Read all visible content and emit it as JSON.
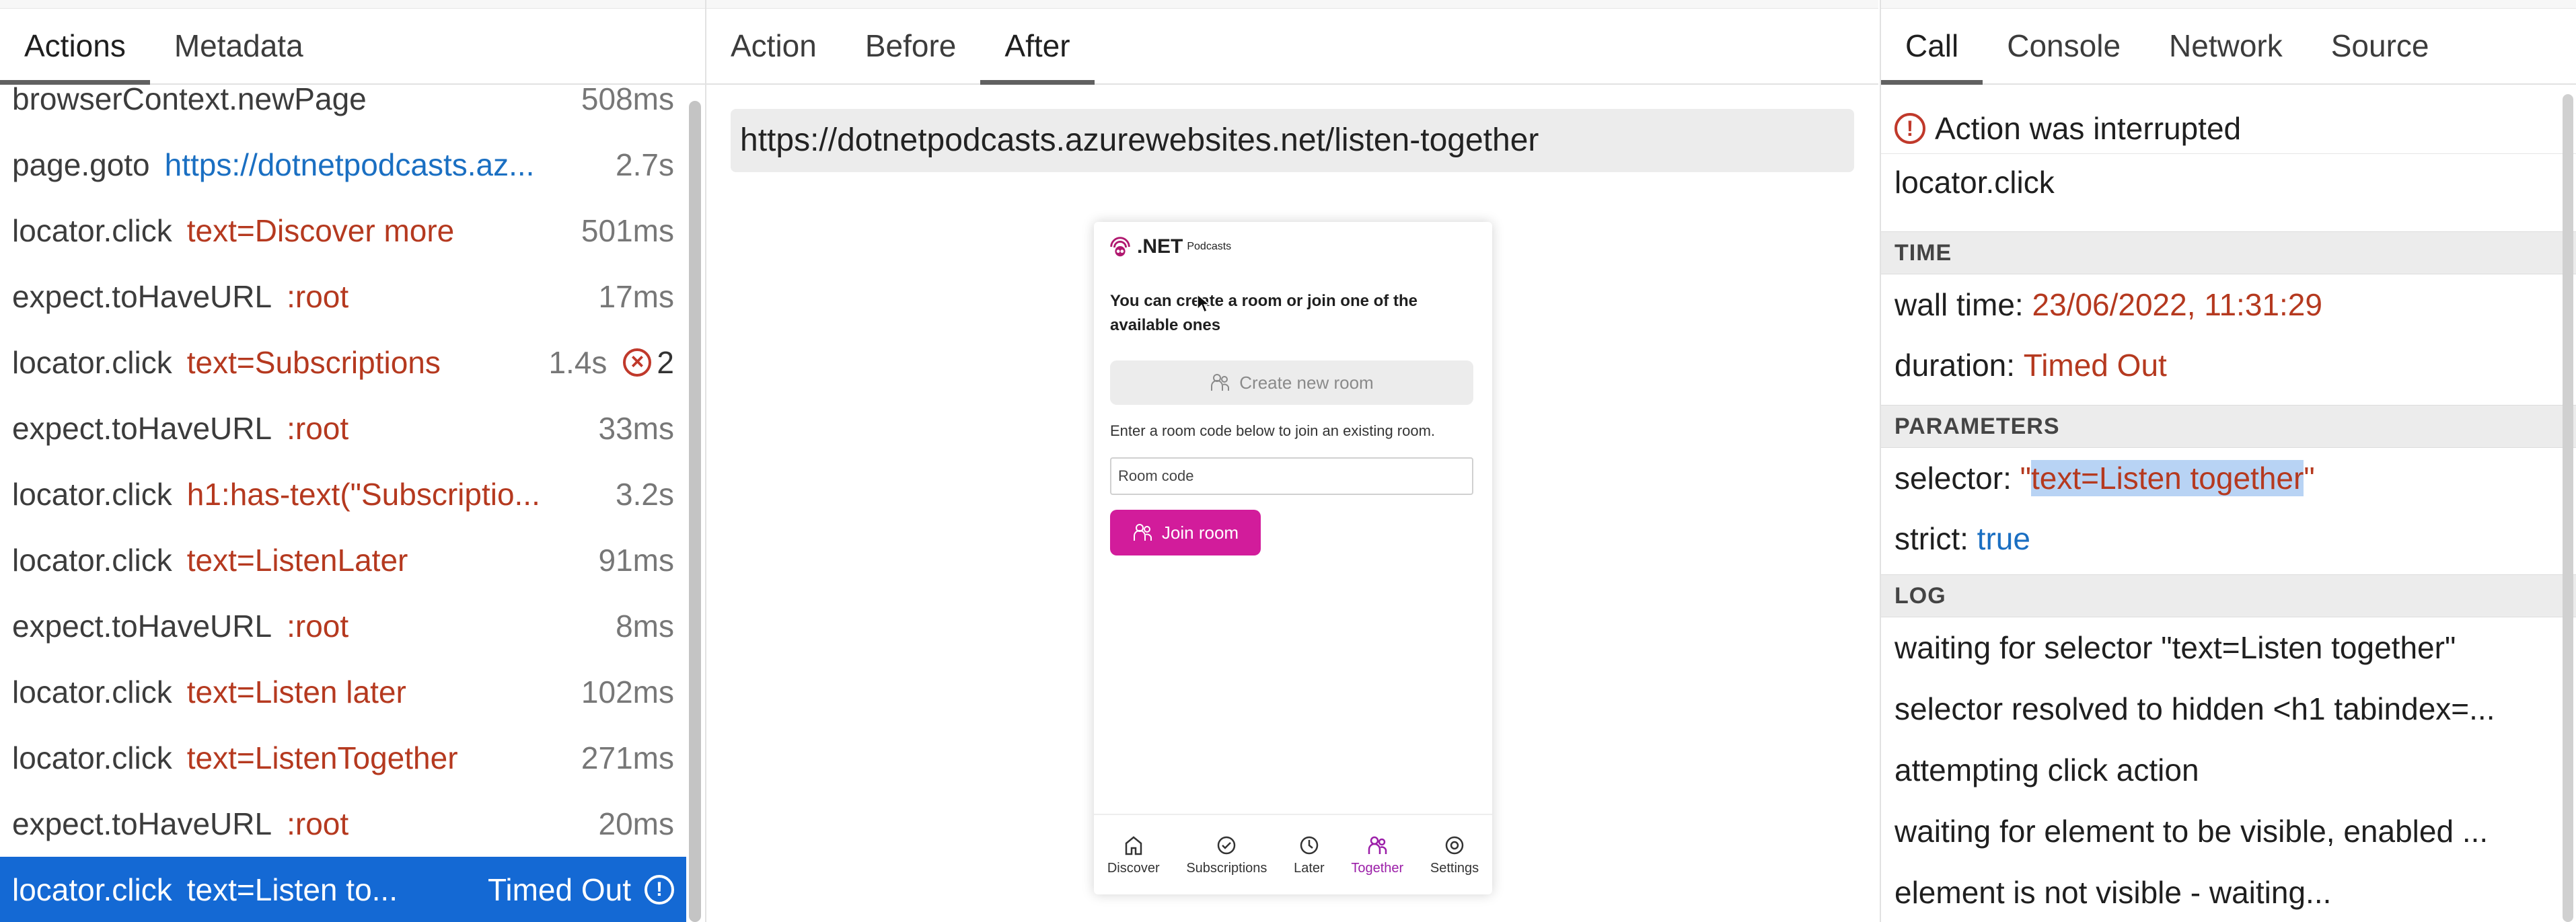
{
  "left": {
    "tabs": [
      "Actions",
      "Metadata"
    ],
    "actions": [
      {
        "method": "browserContext.newPage",
        "selector": "",
        "duration": "508ms"
      },
      {
        "method": "page.goto",
        "selector": "https://dotnetpodcasts.az...",
        "link": true,
        "duration": "2.7s"
      },
      {
        "method": "locator.click",
        "selector": "text=Discover more",
        "duration": "501ms"
      },
      {
        "method": "expect.toHaveURL",
        "selector": ":root",
        "duration": "17ms"
      },
      {
        "method": "locator.click",
        "selector": "text=Subscriptions",
        "duration": "1.4s",
        "errors": "2"
      },
      {
        "method": "expect.toHaveURL",
        "selector": ":root",
        "duration": "33ms"
      },
      {
        "method": "locator.click",
        "selector": "h1:has-text(\"Subscriptio...",
        "duration": "3.2s"
      },
      {
        "method": "locator.click",
        "selector": "text=ListenLater",
        "duration": "91ms"
      },
      {
        "method": "expect.toHaveURL",
        "selector": ":root",
        "duration": "8ms"
      },
      {
        "method": "locator.click",
        "selector": "text=Listen later",
        "duration": "102ms"
      },
      {
        "method": "locator.click",
        "selector": "text=ListenTogether",
        "duration": "271ms"
      },
      {
        "method": "expect.toHaveURL",
        "selector": ":root",
        "duration": "20ms"
      },
      {
        "method": "locator.click",
        "selector": "text=Listen to...",
        "duration": "Timed Out",
        "selected": true
      }
    ]
  },
  "middle": {
    "tabs": [
      "Action",
      "Before",
      "After"
    ],
    "url": "https://dotnetpodcasts.azurewebsites.net/listen-together",
    "app": {
      "brand": ".NET",
      "brand_sub": "Podcasts",
      "intro": "You can create a room or join one of the available ones",
      "create_label": "Create new room",
      "hint": "Enter a room code below to join an existing room.",
      "room_placeholder": "Room code",
      "join_label": "Join room",
      "nav": [
        "Discover",
        "Subscriptions",
        "Later",
        "Together",
        "Settings"
      ],
      "nav_active": "Together",
      "accent": "#d21c9b"
    }
  },
  "right": {
    "tabs": [
      "Call",
      "Console",
      "Network",
      "Source"
    ],
    "status": "Action was interrupted",
    "method": "locator.click",
    "time_header": "TIME",
    "wall_label": "wall time:",
    "wall_value": "23/06/2022, 11:31:29",
    "duration_label": "duration:",
    "duration_value": "Timed Out",
    "params_header": "PARAMETERS",
    "selector_label": "selector:",
    "selector_value": "text=Listen together",
    "strict_label": "strict:",
    "strict_value": "true",
    "log_header": "LOG",
    "log": [
      "waiting for selector \"text=Listen together\"",
      "selector resolved to hidden <h1 tabindex=...",
      "attempting click action",
      "waiting for element to be visible, enabled ...",
      "element is not visible - waiting..."
    ]
  },
  "colors": {
    "selected_row": "#1469d4",
    "error": "#c0392b",
    "selector_text": "#b5391f",
    "link_text": "#1a6fc2"
  }
}
